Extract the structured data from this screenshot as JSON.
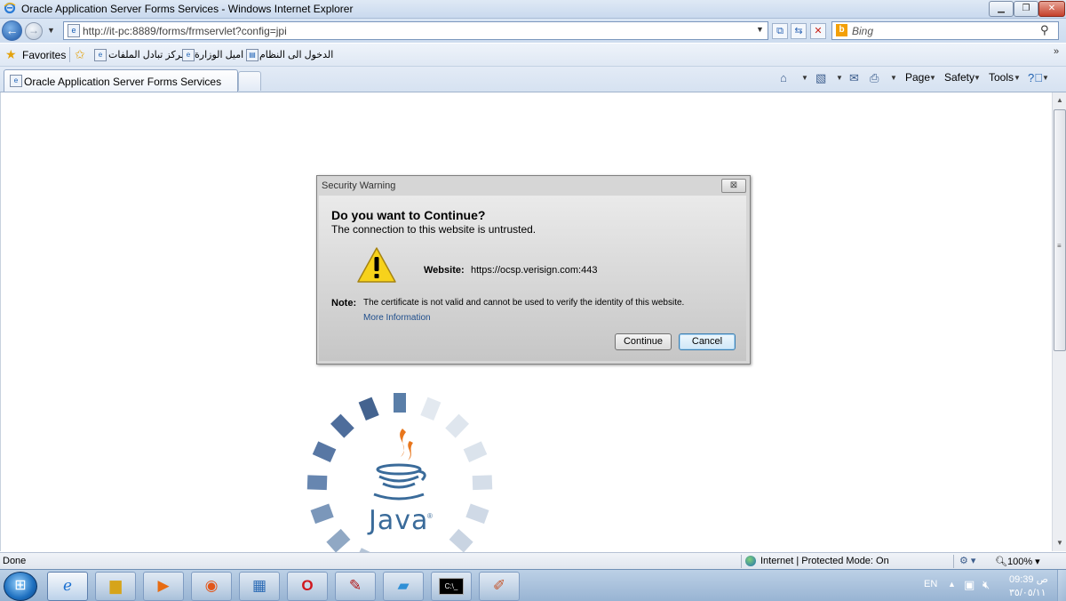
{
  "window": {
    "title": "Oracle Application Server Forms Services - Windows Internet Explorer"
  },
  "address_bar": {
    "url": "http://it-pc:8889/forms/frmservlet?config=jpi"
  },
  "search": {
    "placeholder": "Bing"
  },
  "favorites_bar": {
    "label": "Favorites",
    "links": [
      "مركز تبادل الملفات",
      "اميل الوزارة",
      "الدخول الى النظام"
    ]
  },
  "tabs": [
    {
      "label": "Oracle Application Server Forms Services"
    }
  ],
  "command_bar": {
    "page": "Page",
    "safety": "Safety",
    "tools": "Tools"
  },
  "dialog": {
    "title": "Security Warning",
    "heading": "Do you want to Continue?",
    "subheading": "The connection to this website is untrusted.",
    "website_label": "Website:",
    "website_value": "https://ocsp.verisign.com:443",
    "note_label": "Note:",
    "note_text": "The certificate is not valid and cannot be used to verify the identity of this website.",
    "more_info": "More Information",
    "continue": "Continue",
    "cancel": "Cancel"
  },
  "java": {
    "logo_text": "Java",
    "trademark": "®"
  },
  "status_bar": {
    "text": "Done",
    "zone": "Internet | Protected Mode: On",
    "zoom": "100%"
  },
  "taskbar": {
    "lang": "EN",
    "time": "ص 09:39",
    "date": "٣٥/٠٥/١١"
  },
  "colors": {
    "dialog_bg": "#d6d6d6",
    "link": "#1f4e8c",
    "warning_yellow": "#f7d21b",
    "java_blue": "#3a6b9a",
    "java_orange": "#e8761c"
  }
}
